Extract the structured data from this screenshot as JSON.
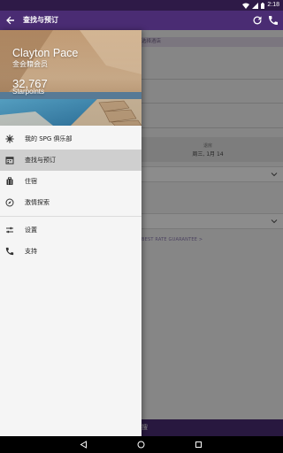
{
  "status_bar": {
    "time": "2:18"
  },
  "app_bar": {
    "title": "查找与预订",
    "icons": [
      "back-arrow-icon",
      "refresh-icon",
      "phone-icon"
    ]
  },
  "background": {
    "hotel_bar_label": "选择酒店",
    "dates_label": "退房",
    "dates_value": "周三, 1月 14",
    "rate_link": "BEST RATE GUARANTEE >",
    "search_button": "搜"
  },
  "drawer": {
    "member_name": "Clayton Pace",
    "member_level": "金会籍会员",
    "points": "32,767",
    "points_label": "Starpoints",
    "items": [
      {
        "label": "我的 SPG 俱乐部",
        "icon": "spg-star-icon",
        "active": false
      },
      {
        "label": "查找与预订",
        "icon": "calendar-icon",
        "active": true
      },
      {
        "label": "住宿",
        "icon": "luggage-icon",
        "active": false
      },
      {
        "label": "激情探索",
        "icon": "compass-icon",
        "active": false
      }
    ],
    "secondary_items": [
      {
        "label": "设置",
        "icon": "settings-sliders-icon"
      },
      {
        "label": "支持",
        "icon": "phone-icon"
      }
    ]
  },
  "colors": {
    "status_bar": "#2e1a47",
    "app_bar": "#4a2c73",
    "active_item": "#cfcfcf"
  }
}
